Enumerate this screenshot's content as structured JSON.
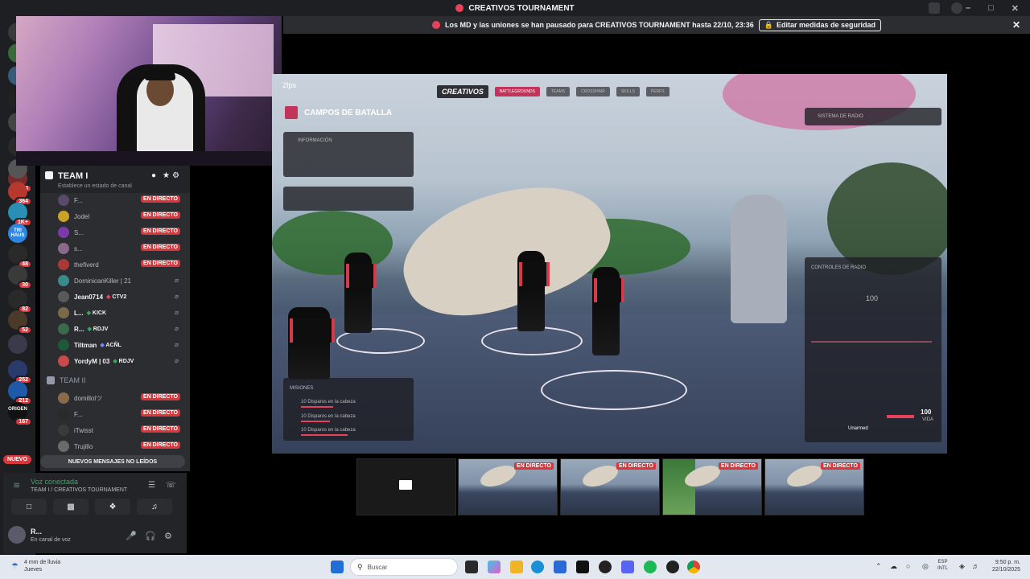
{
  "window": {
    "title": "CREATIVOS TOURNAMENT"
  },
  "notice": {
    "text": "Los MD y las uniones se han pausado para CREATIVOS TOURNAMENT hasta 22/10, 23:36",
    "button_label": "Editar medidas de seguridad"
  },
  "rail": {
    "servers": [
      {
        "badge": "16",
        "color": "#7a2a2a"
      },
      {
        "badge": "364",
        "color": "#b7382f"
      },
      {
        "badge": "1K+",
        "color": "#2a8fb5"
      },
      {
        "label": "TRI HAUS",
        "color": "#2e86de"
      },
      {
        "badge": "48",
        "color": "#2a2a2a"
      },
      {
        "badge": "30",
        "color": "#3a3a3a"
      },
      {
        "badge": "82",
        "color": "#2a2a2a"
      },
      {
        "badge": "52",
        "color": "#4a3a2a"
      },
      {
        "badge": "",
        "color": "#3a3a4a"
      },
      {
        "badge": "252",
        "color": "#2a3a6a"
      },
      {
        "badge": "212",
        "color": "#1e5aa8"
      },
      {
        "label": "ORIGEN",
        "badge": "167",
        "color": "#111111"
      }
    ],
    "new_label": "NUEVO"
  },
  "channel": {
    "name": "TEAM I",
    "status": "Establece un estado de canal",
    "members": [
      {
        "name": "F...",
        "live": true,
        "avatar": "#5a4a6a"
      },
      {
        "name": "Jodel",
        "live": true,
        "avatar": "#c9a227"
      },
      {
        "name": "S...",
        "live": true,
        "avatar": "#7a3aa8"
      },
      {
        "name": "s...",
        "live": true,
        "avatar": "#8a6a8a"
      },
      {
        "name": "thefiverd",
        "live": true,
        "avatar": "#a83a3a"
      },
      {
        "name": "DominicanKiller | 21",
        "live": false,
        "avatar": "#3a8a8a"
      },
      {
        "name": "Jean0714",
        "tag": "CTV2",
        "tag_color": "r",
        "live": false,
        "avatar": "#5a5a5a"
      },
      {
        "name": "L...",
        "tag": "KICK",
        "tag_color": "g",
        "live": false,
        "avatar": "#7a6a4a"
      },
      {
        "name": "R...",
        "tag": "RDJV",
        "tag_color": "g",
        "live": false,
        "avatar": "#3a6a4a"
      },
      {
        "name": "Tiltman",
        "tag": "ACÑL",
        "tag_color": "b",
        "live": false,
        "avatar": "#1e5a3a"
      },
      {
        "name": "YordyM | 03",
        "tag": "RDJV",
        "tag_color": "g",
        "live": false,
        "avatar": "#c94a4a"
      }
    ],
    "team2_name": "TEAM II",
    "team2_members": [
      {
        "name": "domillolツ",
        "live": true,
        "avatar": "#8a6a4a"
      },
      {
        "name": "F...",
        "live": true,
        "avatar": "#2a2a2a"
      },
      {
        "name": "iTwisst",
        "live": true,
        "avatar": "#3a3a3a"
      },
      {
        "name": "Trujillo",
        "live": true,
        "avatar": "#6a6a6a"
      }
    ],
    "live_label": "EN DIRECTO",
    "unread_label": "NUEVOS MENSAJES NO LEÍDOS"
  },
  "voice": {
    "status": "Voz conectada",
    "channel": "TEAM I / CREATIVOS TOURNAMENT",
    "user_name": "R...",
    "user_status": "En canal de voz"
  },
  "stream": {
    "fps": "2fps",
    "game_brand": "CREATIVOS",
    "game_tabs": [
      "BATTLEGROUNDS",
      "TEAMS",
      "CROSSHAIR",
      "SKILLS",
      "PERFIL"
    ],
    "panel_title": "CAMPOS DE BATALLA",
    "info_label": "INFORMACIÓN",
    "radio_system": "SISTEMA DE RADIO",
    "radio_controls": "CONTROLES DE RADIO",
    "radio_value": "100",
    "missions_label": "MISIONES",
    "mission_item": "10 Disparos en la cabeza",
    "hp_value": "100",
    "hp_label": "VIDA",
    "unarmed": "Unarmed"
  },
  "thumbnails": [
    {
      "live": false,
      "kind": "screen"
    },
    {
      "live": true,
      "kind": "game"
    },
    {
      "live": true,
      "kind": "game"
    },
    {
      "live": true,
      "kind": "green"
    },
    {
      "live": true,
      "kind": "game"
    }
  ],
  "taskbar": {
    "weather_temp": "4 mm de lluvia",
    "weather_day": "Jueves",
    "search_placeholder": "Buscar",
    "lang_top": "ESP",
    "lang_bottom": "INTL",
    "time": "9:50 p. m.",
    "date": "22/10/2025"
  }
}
